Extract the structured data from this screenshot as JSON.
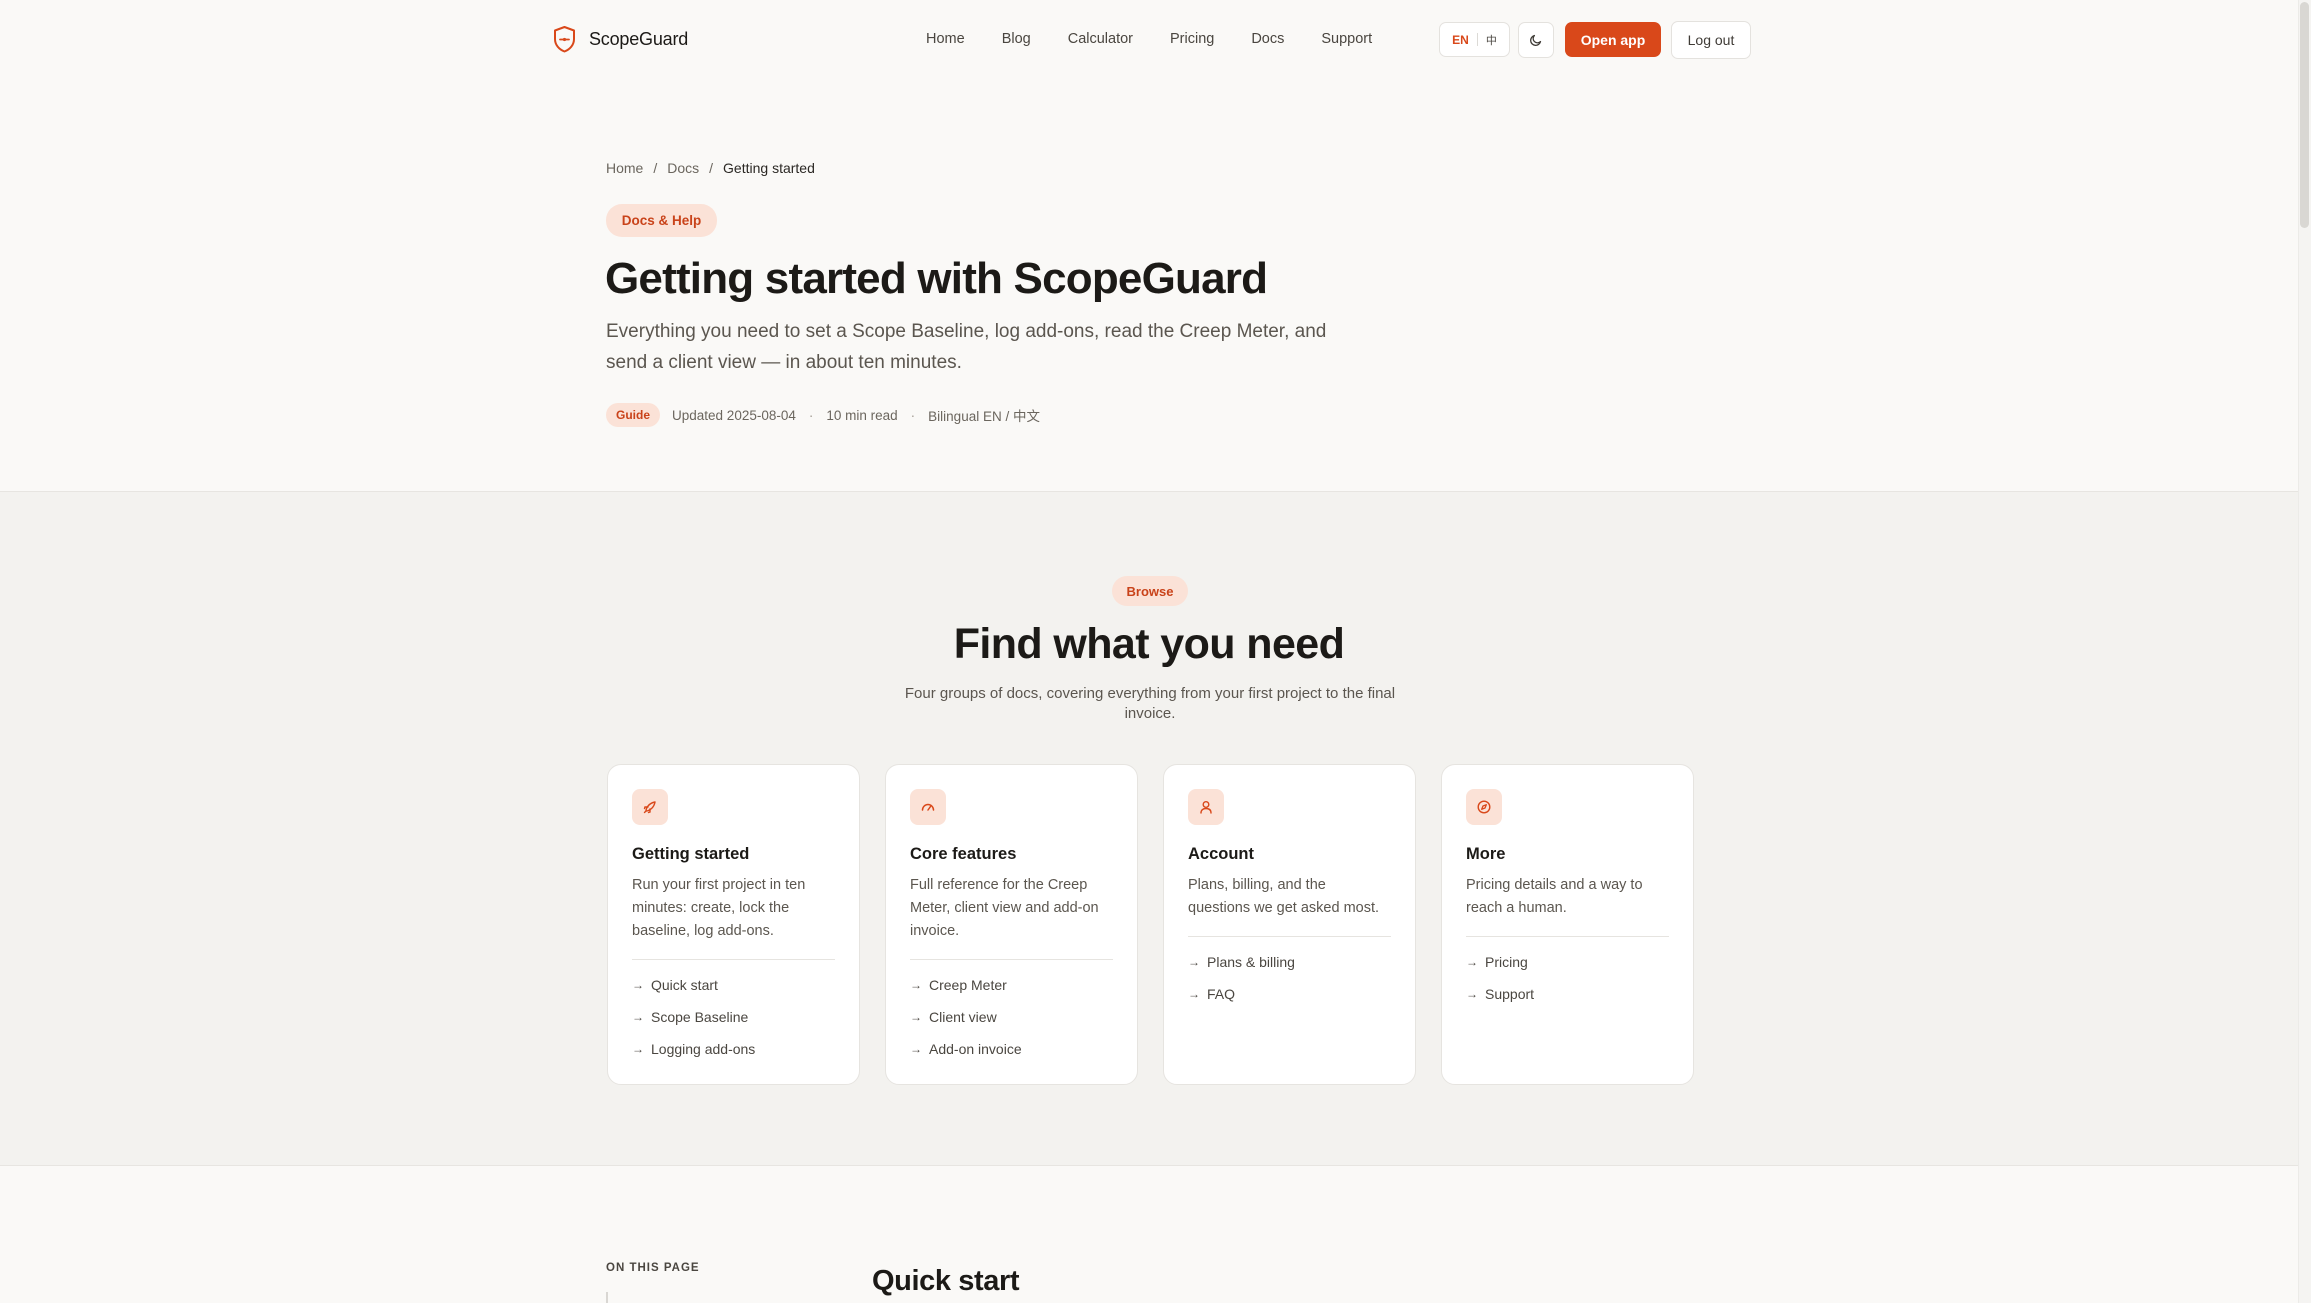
{
  "header": {
    "brand": "ScopeGuard",
    "nav": [
      "Home",
      "Blog",
      "Calculator",
      "Pricing",
      "Docs",
      "Support"
    ],
    "lang_en": "EN",
    "lang_zh": "中",
    "open_app": "Open app",
    "logout": "Log out"
  },
  "breadcrumb": [
    "Home",
    "Docs",
    "Getting started"
  ],
  "hero": {
    "pill": "Docs & Help",
    "title": "Getting started with ScopeGuard",
    "subtitle": "Everything you need to set a Scope Baseline, log add-ons, read the Creep Meter, and send a client view — in about ten minutes.",
    "meta_tag": "Guide",
    "updated": "Updated 2025-08-04",
    "read_time": "10 min read",
    "bilingual": "Bilingual EN / 中文"
  },
  "browse": {
    "pill": "Browse",
    "title": "Find what you need",
    "subtitle": "Four groups of docs, covering everything from your first project to the final invoice.",
    "cards": [
      {
        "icon": "rocket-icon",
        "title": "Getting started",
        "desc": "Run your first project in ten minutes: create, lock the baseline, log add-ons.",
        "links": [
          "Quick start",
          "Scope Baseline",
          "Logging add-ons"
        ]
      },
      {
        "icon": "gauge-icon",
        "title": "Core features",
        "desc": "Full reference for the Creep Meter, client view and add-on invoice.",
        "links": [
          "Creep Meter",
          "Client view",
          "Add-on invoice"
        ]
      },
      {
        "icon": "user-icon",
        "title": "Account",
        "desc": "Plans, billing, and the questions we get asked most.",
        "links": [
          "Plans & billing",
          "FAQ"
        ]
      },
      {
        "icon": "compass-icon",
        "title": "More",
        "desc": "Pricing details and a way to reach a human.",
        "links": [
          "Pricing",
          "Support"
        ]
      }
    ]
  },
  "toc": {
    "label": "ON THIS PAGE"
  },
  "section": {
    "title": "Quick start"
  },
  "colors": {
    "accent": "#d9481a",
    "accent_soft": "#fbe2d7",
    "background": "#faf9f7",
    "section_bg": "#f3f2ef"
  }
}
